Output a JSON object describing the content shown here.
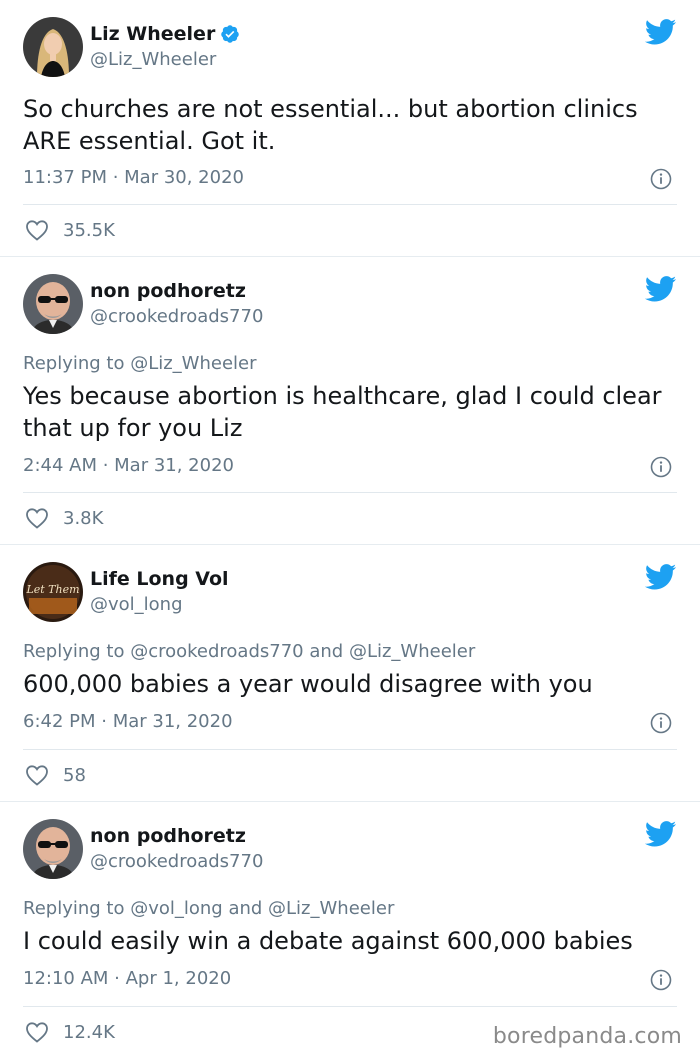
{
  "colors": {
    "twitter_blue": "#1da1f2",
    "text_primary": "#14171a",
    "text_secondary": "#657786",
    "divider": "#e1e8ed"
  },
  "tweets": [
    {
      "display_name": "Liz Wheeler",
      "handle": "@Liz_Wheeler",
      "verified": true,
      "replying_to": "",
      "text": "So churches are not essential... but abortion clinics ARE essential. Got it.",
      "timestamp": "11:37 PM · Mar 30, 2020",
      "likes": "35.5K",
      "avatar_icon": "woman-blonde-avatar"
    },
    {
      "display_name": "non podhoretz",
      "handle": "@crookedroads770",
      "verified": false,
      "replying_to_prefix": "Replying to ",
      "replying_to": "@Liz_Wheeler",
      "text": "Yes because abortion is healthcare, glad I could clear that up for you Liz",
      "timestamp": "2:44 AM · Mar 31, 2020",
      "likes": "3.8K",
      "avatar_icon": "bald-man-sunglasses-avatar"
    },
    {
      "display_name": "Life Long Vol",
      "handle": "@vol_long",
      "verified": false,
      "replying_to_prefix": "Replying to ",
      "replying_to": "@crookedroads770",
      "replying_to_and": " and ",
      "replying_to_2": "@Liz_Wheeler",
      "text": "600,000 babies a year would disagree with you",
      "timestamp": "6:42 PM · Mar 31, 2020",
      "likes": "58",
      "avatar_icon": "let-them-logo-avatar",
      "avatar_text": "Let Them"
    },
    {
      "display_name": "non podhoretz",
      "handle": "@crookedroads770",
      "verified": false,
      "replying_to_prefix": "Replying to ",
      "replying_to": "@vol_long",
      "replying_to_and": " and ",
      "replying_to_2": "@Liz_Wheeler",
      "text": "I could easily win a debate against 600,000 babies",
      "timestamp": "12:10 AM · Apr 1, 2020",
      "likes": "12.4K",
      "avatar_icon": "bald-man-sunglasses-avatar"
    }
  ],
  "watermark": "boredpanda.com"
}
